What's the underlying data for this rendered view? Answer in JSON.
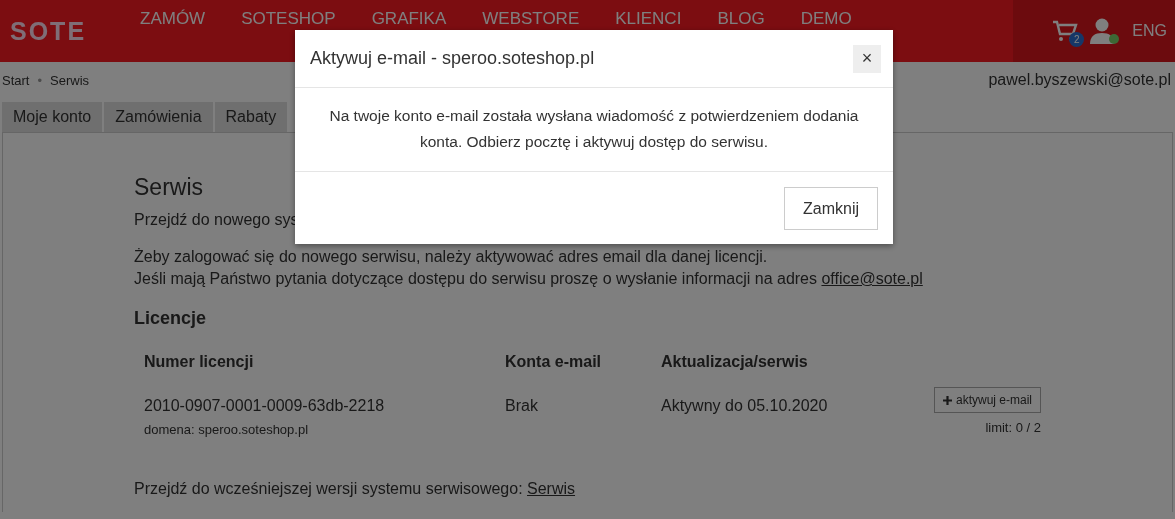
{
  "header": {
    "logo": "SOTE",
    "nav": [
      "ZAMÓW",
      "SOTESHOP",
      "GRAFIKA",
      "WEBSTORE",
      "KLIENCI",
      "BLOG",
      "DEMO"
    ],
    "cart_count": "2",
    "language": "ENG"
  },
  "breadcrumb": {
    "items": [
      "Start",
      "Serwis"
    ],
    "separator": "•"
  },
  "user_email": "pawel.byszewski@sote.pl",
  "tabs": [
    {
      "label": "Moje konto",
      "selected": false
    },
    {
      "label": "Zamówienia",
      "selected": false
    },
    {
      "label": "Rabaty",
      "selected": false
    }
  ],
  "content": {
    "title": "Serwis",
    "intro": "Przejdź do nowego sys",
    "info": "Żeby zalogować się do nowego serwisu, należy aktywować adres email dla danej licencji.",
    "contact": {
      "text": "Jeśli mają Państwo pytania dotyczące dostępu do serwisu proszę o wysłanie informacji na adres",
      "link": "office@sote.pl"
    },
    "licenses_title": "Licencje",
    "table": {
      "columns": [
        "Numer licencji",
        "Konta e-mail",
        "Aktualizacja/serwis"
      ],
      "rows": [
        {
          "number": "2010-0907-0001-0009-63db-2218",
          "domain": "domena: speroo.soteshop.pl",
          "accounts": "Brak",
          "status": "Aktywny do 05.10.2020",
          "action": "aktywuj e-mail",
          "limit": "limit: 0 / 2"
        }
      ]
    },
    "old_version": {
      "text": "Przejdź do wcześniejszej wersji systemu serwisowego:",
      "link": "Serwis"
    }
  },
  "modal": {
    "title": "Aktywuj e-mail - speroo.soteshop.pl",
    "close": "×",
    "message": "Na twoje konto e-mail została wysłana wiadomość z potwierdzeniem dodania konta. Odbierz pocztę i aktywuj dostęp do serwisu.",
    "button": "Zamknij"
  }
}
